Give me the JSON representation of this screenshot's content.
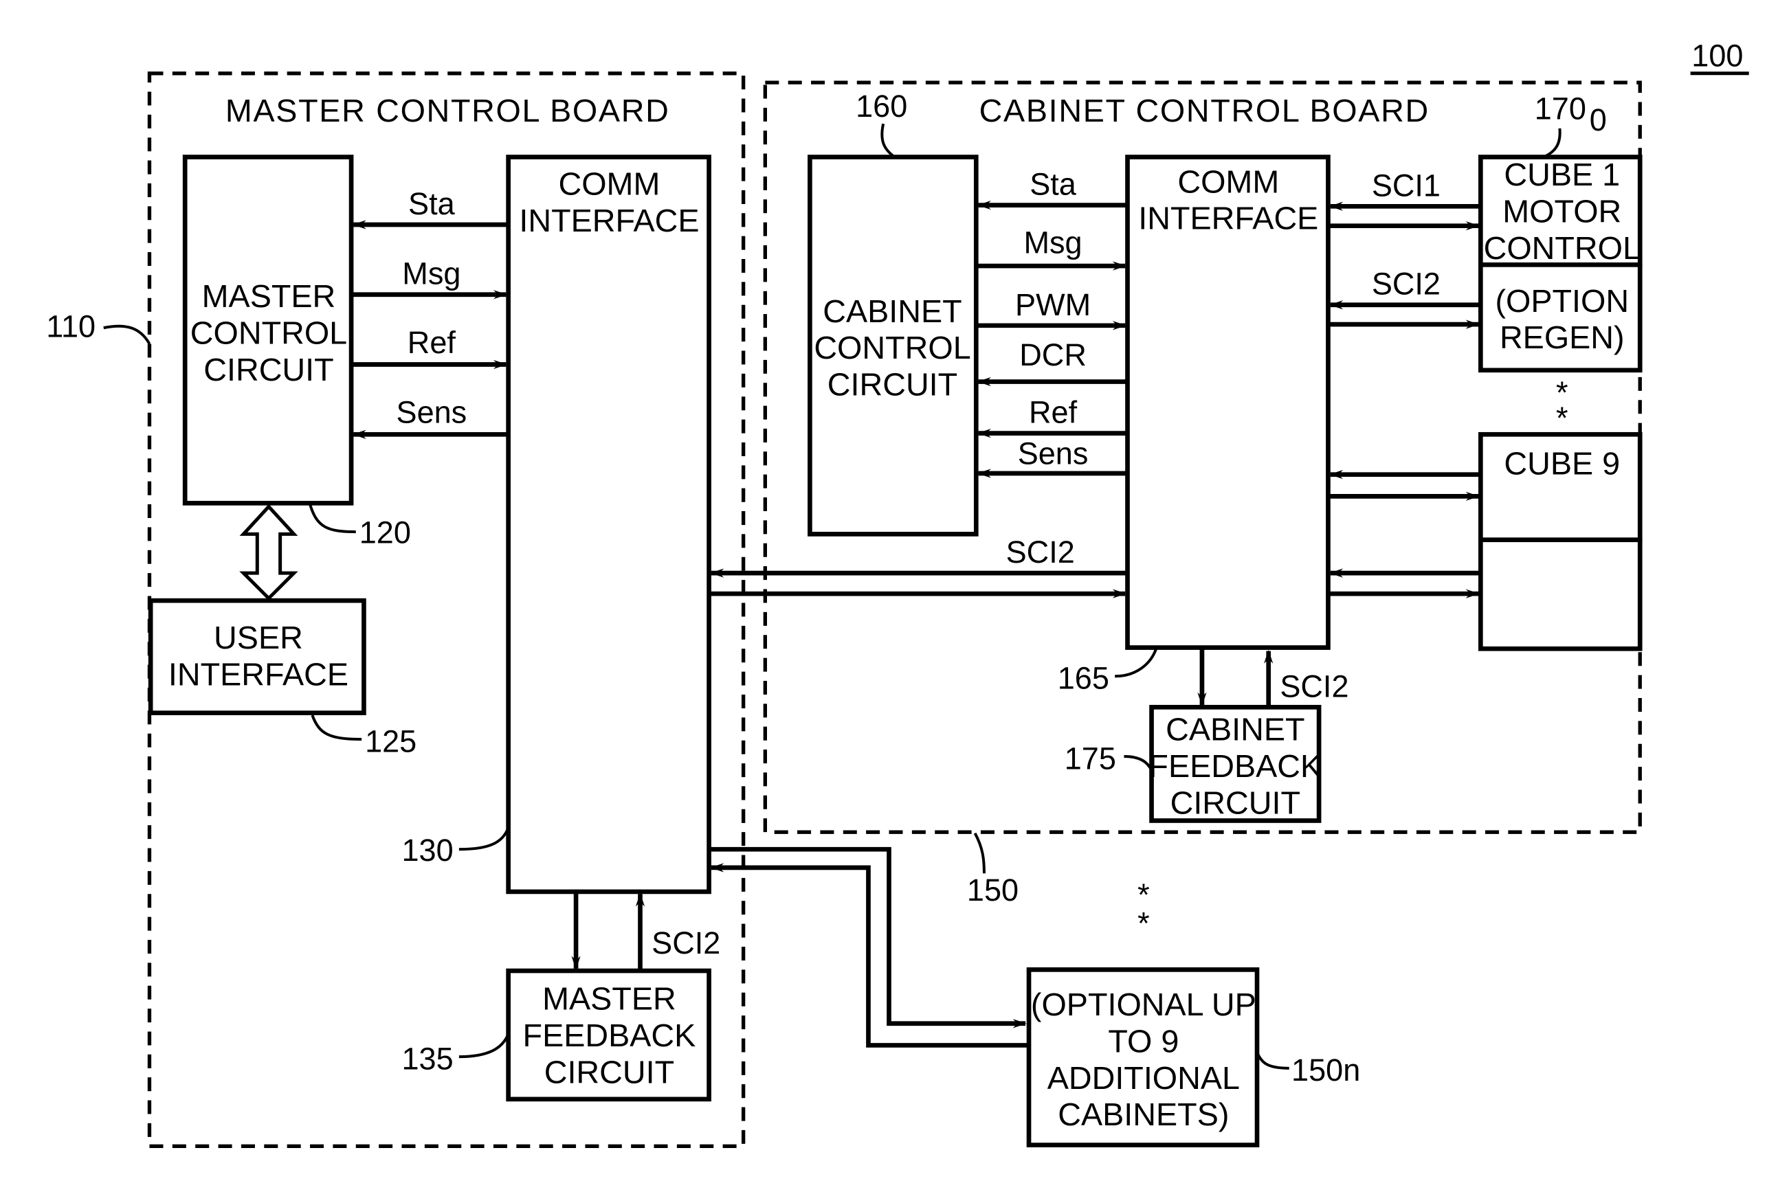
{
  "figure_ref": "100",
  "master_board": {
    "title": "MASTER CONTROL BOARD",
    "ref": "110",
    "master_control_circuit": {
      "lines": [
        "MASTER",
        "CONTROL",
        "CIRCUIT"
      ],
      "ref": "120"
    },
    "user_interface": {
      "lines": [
        "USER",
        "INTERFACE"
      ],
      "ref": "125"
    },
    "comm_interface": {
      "lines": [
        "COMM",
        "INTERFACE"
      ],
      "ref": "130"
    },
    "master_feedback": {
      "lines": [
        "MASTER",
        "FEEDBACK",
        "CIRCUIT"
      ],
      "ref": "135"
    },
    "signals": [
      "Sta",
      "Msg",
      "Ref",
      "Sens"
    ],
    "feedback_signal": "SCI2"
  },
  "cabinet_board": {
    "title": "CABINET CONTROL BOARD",
    "ref": "150",
    "cabinet_control_circuit": {
      "lines": [
        "CABINET",
        "CONTROL",
        "CIRCUIT"
      ],
      "ref": "160"
    },
    "comm_interface": {
      "lines": [
        "COMM",
        "INTERFACE"
      ],
      "ref": "165"
    },
    "cabinet_feedback": {
      "lines": [
        "CABINET",
        "FEEDBACK",
        "CIRCUIT"
      ],
      "ref": "175"
    },
    "signals": [
      "Sta",
      "Msg",
      "PWM",
      "DCR",
      "Ref",
      "Sens"
    ],
    "sci1": "SCI1",
    "sci2_top": "SCI2",
    "sci2_bus": "SCI2",
    "feedback_signal": "SCI2",
    "cube1": {
      "lines": [
        "CUBE 1",
        "MOTOR",
        "CONTROL"
      ],
      "ref": "170",
      "ref_sub": "0"
    },
    "cube1_option": {
      "lines": [
        "(OPTION",
        "REGEN)"
      ]
    },
    "cube9": {
      "lines": [
        "CUBE 9"
      ]
    },
    "ellipsis": [
      "*",
      "*"
    ]
  },
  "additional": {
    "lines": [
      "(OPTIONAL UP",
      "TO 9",
      "ADDITIONAL",
      "CABINETS)"
    ],
    "ref": "150n",
    "ellipsis": [
      "*",
      "*"
    ]
  }
}
